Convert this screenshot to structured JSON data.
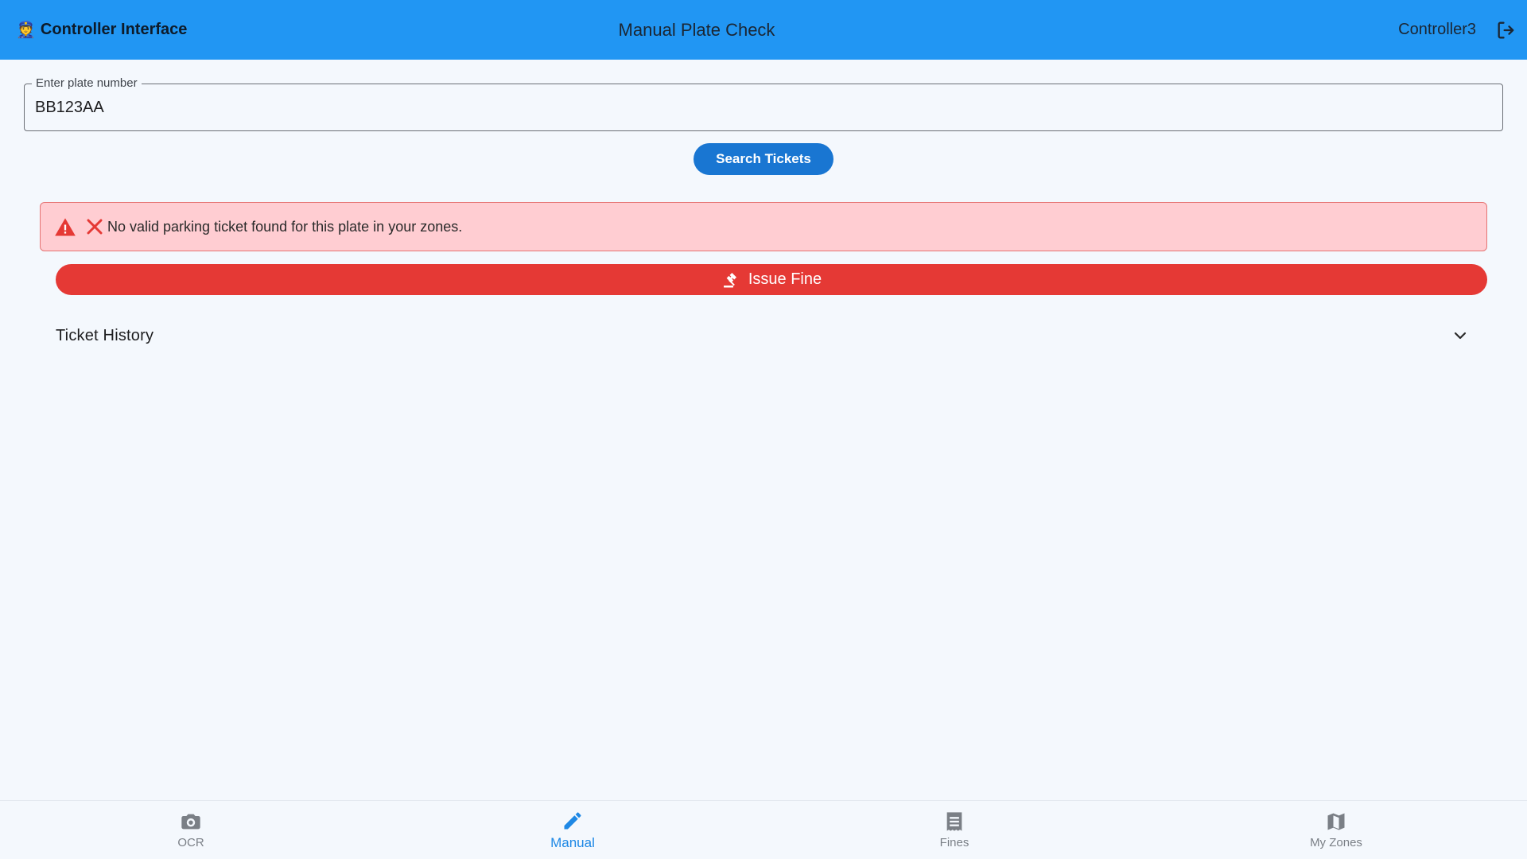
{
  "appbar": {
    "brand_emoji": "👮",
    "brand": "Controller Interface",
    "title": "Manual Plate Check",
    "user": "Controller3",
    "logout_icon": "logout-icon"
  },
  "plate": {
    "label": "Enter plate number",
    "value": "BB123AA"
  },
  "search_button": "Search Tickets",
  "alert": {
    "message": "No valid parking ticket found for this plate in your zones.",
    "warning_icon": "warning-icon",
    "error_icon": "close-icon"
  },
  "fine_button": "Issue Fine",
  "history": {
    "label": "Ticket History"
  },
  "nav": [
    {
      "label": "OCR",
      "icon": "camera-icon",
      "active": false
    },
    {
      "label": "Manual",
      "icon": "pencil-icon",
      "active": true
    },
    {
      "label": "Fines",
      "icon": "receipt-icon",
      "active": false
    },
    {
      "label": "My Zones",
      "icon": "map-icon",
      "active": false
    }
  ],
  "colors": {
    "appbar": "#2196f3",
    "primary_button": "#1976d2",
    "alert_bg": "#ffcdd2",
    "alert_border": "#e57373",
    "danger": "#e53935",
    "nav_active": "#1e88e5",
    "nav_inactive": "#7a7f86"
  }
}
